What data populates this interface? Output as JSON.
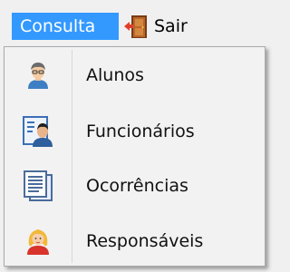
{
  "menubar": {
    "consulta_label": "Consulta",
    "sair_label": "Sair"
  },
  "dropdown": {
    "items": [
      {
        "label": "Alunos",
        "icon": "student-icon"
      },
      {
        "label": "Funcionários",
        "icon": "employee-icon"
      },
      {
        "label": "Ocorrências",
        "icon": "documents-icon"
      },
      {
        "label": "Responsáveis",
        "icon": "guardian-icon"
      }
    ]
  },
  "colors": {
    "highlight": "#3399ff",
    "menu_bg": "#f0f0f0",
    "dropdown_bg": "#f2f2f2"
  }
}
